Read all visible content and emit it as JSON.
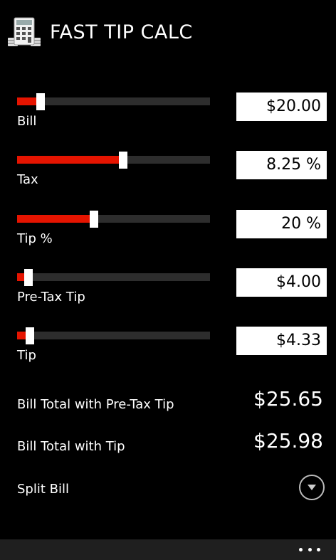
{
  "app": {
    "title": "FAST TIP CALC"
  },
  "colors": {
    "accent": "#e51400",
    "track": "#2d2d2d",
    "background": "#000000",
    "app_bar": "#1f1f1f"
  },
  "inputs": [
    {
      "id": "bill",
      "label": "Bill",
      "value": "$20.00",
      "slider_fraction": 0.12
    },
    {
      "id": "tax",
      "label": "Tax",
      "value": "8.25 %",
      "slider_fraction": 0.55
    },
    {
      "id": "tip-percent",
      "label": "Tip %",
      "value": "20 %",
      "slider_fraction": 0.4
    },
    {
      "id": "pre-tax-tip",
      "label": "Pre-Tax Tip",
      "value": "$4.00",
      "slider_fraction": 0.06
    },
    {
      "id": "tip",
      "label": "Tip",
      "value": "$4.33",
      "slider_fraction": 0.065
    }
  ],
  "totals": {
    "pre_tax": {
      "label": "Bill Total with Pre-Tax Tip",
      "value": "$25.65"
    },
    "with_tip": {
      "label": "Bill Total with Tip",
      "value": "$25.98"
    }
  },
  "split": {
    "label": "Split Bill",
    "icon": "chevron-down-icon"
  },
  "app_bar": {
    "icon": "more-icon"
  }
}
